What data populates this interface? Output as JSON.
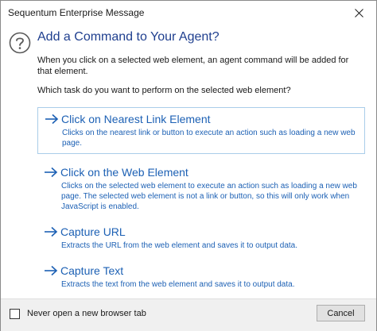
{
  "window": {
    "title": "Sequentum Enterprise Message"
  },
  "header": {
    "title": "Add a Command to Your Agent?",
    "intro": "When you click on a selected web element, an agent command will be added for that element.",
    "question": "Which task do you want to perform on the selected web element?"
  },
  "options": [
    {
      "title": "Click on Nearest Link Element",
      "description": "Clicks on the nearest link or button to execute an action such as loading a new web page.",
      "selected": true
    },
    {
      "title": "Click on the Web Element",
      "description": "Clicks on the selected web element to execute an action such as loading a new web page. The selected web element is not a link or button, so this will only work when JavaScript is enabled.",
      "selected": false
    },
    {
      "title": "Capture URL",
      "description": "Extracts the URL from the web element and saves it to output data.",
      "selected": false
    },
    {
      "title": "Capture Text",
      "description": "Extracts the text from the web element and saves it to output data.",
      "selected": false
    }
  ],
  "footer": {
    "checkbox_label": "Never open a new browser tab",
    "checkbox_checked": false,
    "cancel_label": "Cancel"
  },
  "colors": {
    "title_blue": "#1f3f8f",
    "link_blue": "#1c60b4",
    "selected_border": "#a9cde9",
    "footer_bg": "#f0f0f0"
  },
  "icons": {
    "header": "question-circle-icon",
    "option": "arrow-right-icon",
    "close": "close-icon"
  }
}
